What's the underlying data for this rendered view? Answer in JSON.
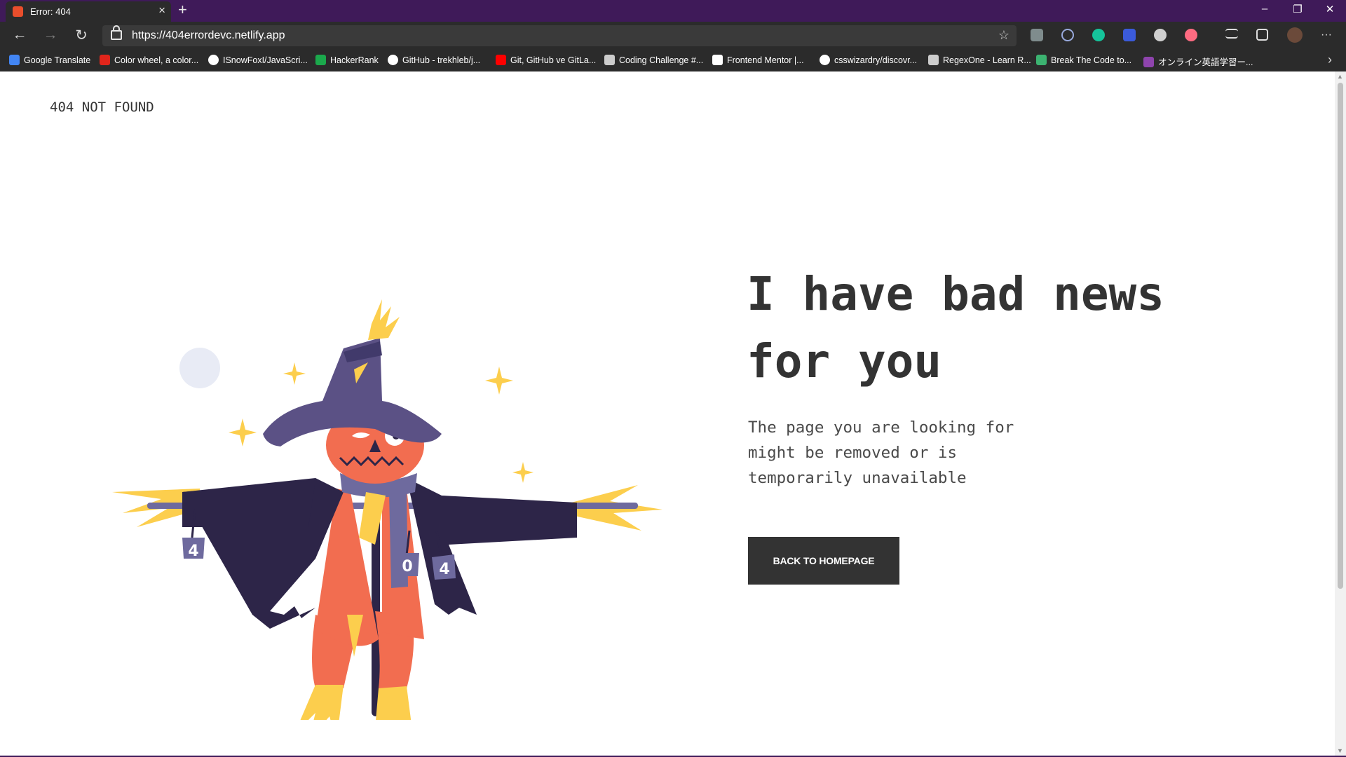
{
  "browser": {
    "tab_title": "Error: 404",
    "tab_close": "×",
    "new_tab": "+",
    "window_controls": {
      "minimize": "–",
      "restore": "❐",
      "close": "✕"
    },
    "nav": {
      "back": "←",
      "forward": "→",
      "reload": "↻"
    },
    "url": "https://404errordevc.netlify.app",
    "star": "☆",
    "more_menu": "···",
    "bookmarks": [
      {
        "label": "Google Translate",
        "icon": "google-translate-icon",
        "color": "#4285f4"
      },
      {
        "label": "Color wheel, a color...",
        "icon": "adobe-icon",
        "color": "#e1251b"
      },
      {
        "label": "ISnowFoxI/JavaScri...",
        "icon": "github-icon",
        "color": "#ffffff"
      },
      {
        "label": "HackerRank",
        "icon": "hackerrank-icon",
        "color": "#1ba94c"
      },
      {
        "label": "GitHub - trekhleb/j...",
        "icon": "github-icon",
        "color": "#ffffff"
      },
      {
        "label": "Git, GitHub ve GitLa...",
        "icon": "youtube-icon",
        "color": "#ff0000"
      },
      {
        "label": "Coding Challenge #...",
        "icon": "codepen-icon",
        "color": "#cccccc"
      },
      {
        "label": "Frontend Mentor |...",
        "icon": "frontend-mentor-icon",
        "color": "#ffffff"
      },
      {
        "label": "csswizardry/discovr...",
        "icon": "github-icon",
        "color": "#ffffff"
      },
      {
        "label": "RegexOne - Learn R...",
        "icon": "regexone-icon",
        "color": "#cccccc"
      },
      {
        "label": "Break The Code to...",
        "icon": "code-icon",
        "color": "#3cb371"
      },
      {
        "label": "オンライン英語学習ー...",
        "icon": "english-learning-icon",
        "color": "#8e44ad"
      }
    ],
    "bookmarks_more": "›"
  },
  "page": {
    "brand": "404 NOT FOUND",
    "headline": "I have bad news for you",
    "subtext": "The page you are looking for might be removed or is temporarily unavailable",
    "button": "BACK TO HOMEPAGE",
    "cans": [
      "4",
      "0",
      "4"
    ]
  },
  "colors": {
    "titlebar": "#3f1a59",
    "chrome": "#2b2b2b",
    "text_dark": "#333333",
    "pumpkin": "#f26d50",
    "hat": "#5b5185",
    "coat": "#2d2548",
    "straw": "#fcce4d",
    "can": "#6e6a9e"
  }
}
